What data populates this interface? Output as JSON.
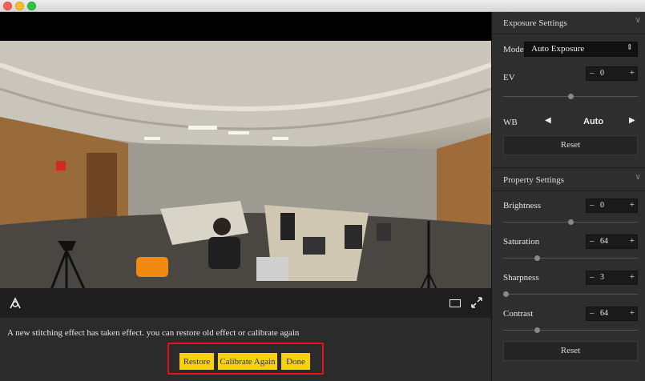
{
  "window": {
    "controls": [
      "close",
      "minimize",
      "zoom"
    ]
  },
  "toolbar": {
    "left_icon": "stitch-icon",
    "right_icons": [
      "frame-icon",
      "fullscreen-icon"
    ]
  },
  "message": "A new stitching effect has taken effect. you can restore old effect or calibrate again",
  "actions": {
    "restore": "Restore",
    "calibrate": "Calibrate Again",
    "done": "Done"
  },
  "exposure": {
    "title": "Exposure Settings",
    "mode_label": "Mode",
    "mode_value": "Auto Exposure",
    "ev_label": "EV",
    "ev_value": "0",
    "ev_level": 0.5,
    "wb_label": "WB",
    "wb_value": "Auto",
    "reset": "Reset"
  },
  "property": {
    "title": "Property Settings",
    "brightness_label": "Brightness",
    "brightness_value": "0",
    "brightness_level": 0.5,
    "saturation_label": "Saturation",
    "saturation_value": "64",
    "saturation_level": 0.25,
    "sharpness_label": "Sharpness",
    "sharpness_value": "3",
    "sharpness_level": 0.0,
    "contrast_label": "Contrast",
    "contrast_value": "64",
    "contrast_level": 0.25,
    "reset": "Reset"
  },
  "colors": {
    "accent_button": "#f5d20a",
    "highlight_border": "#e4101a",
    "panel_bg": "#2e2e2e"
  }
}
